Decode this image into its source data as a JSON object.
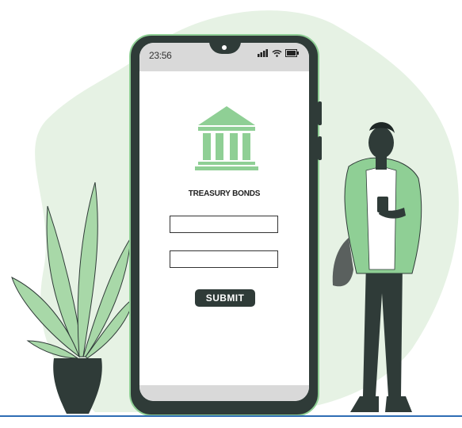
{
  "phone": {
    "status_time": "23:56",
    "app_title": "TREASURY BONDS",
    "fields": [
      {
        "name": "field-1",
        "value": "",
        "placeholder": ""
      },
      {
        "name": "field-2",
        "value": "",
        "placeholder": ""
      }
    ],
    "submit_label": "SUBMIT"
  },
  "icons": {
    "bank": "bank-icon",
    "signal": "signal-icon",
    "wifi": "wifi-icon",
    "battery": "battery-icon"
  },
  "colors": {
    "accent_green": "#8fcf95",
    "dark": "#2f3b38",
    "blob_bg": "#e6f2e4",
    "ground_line": "#2e6db4"
  }
}
